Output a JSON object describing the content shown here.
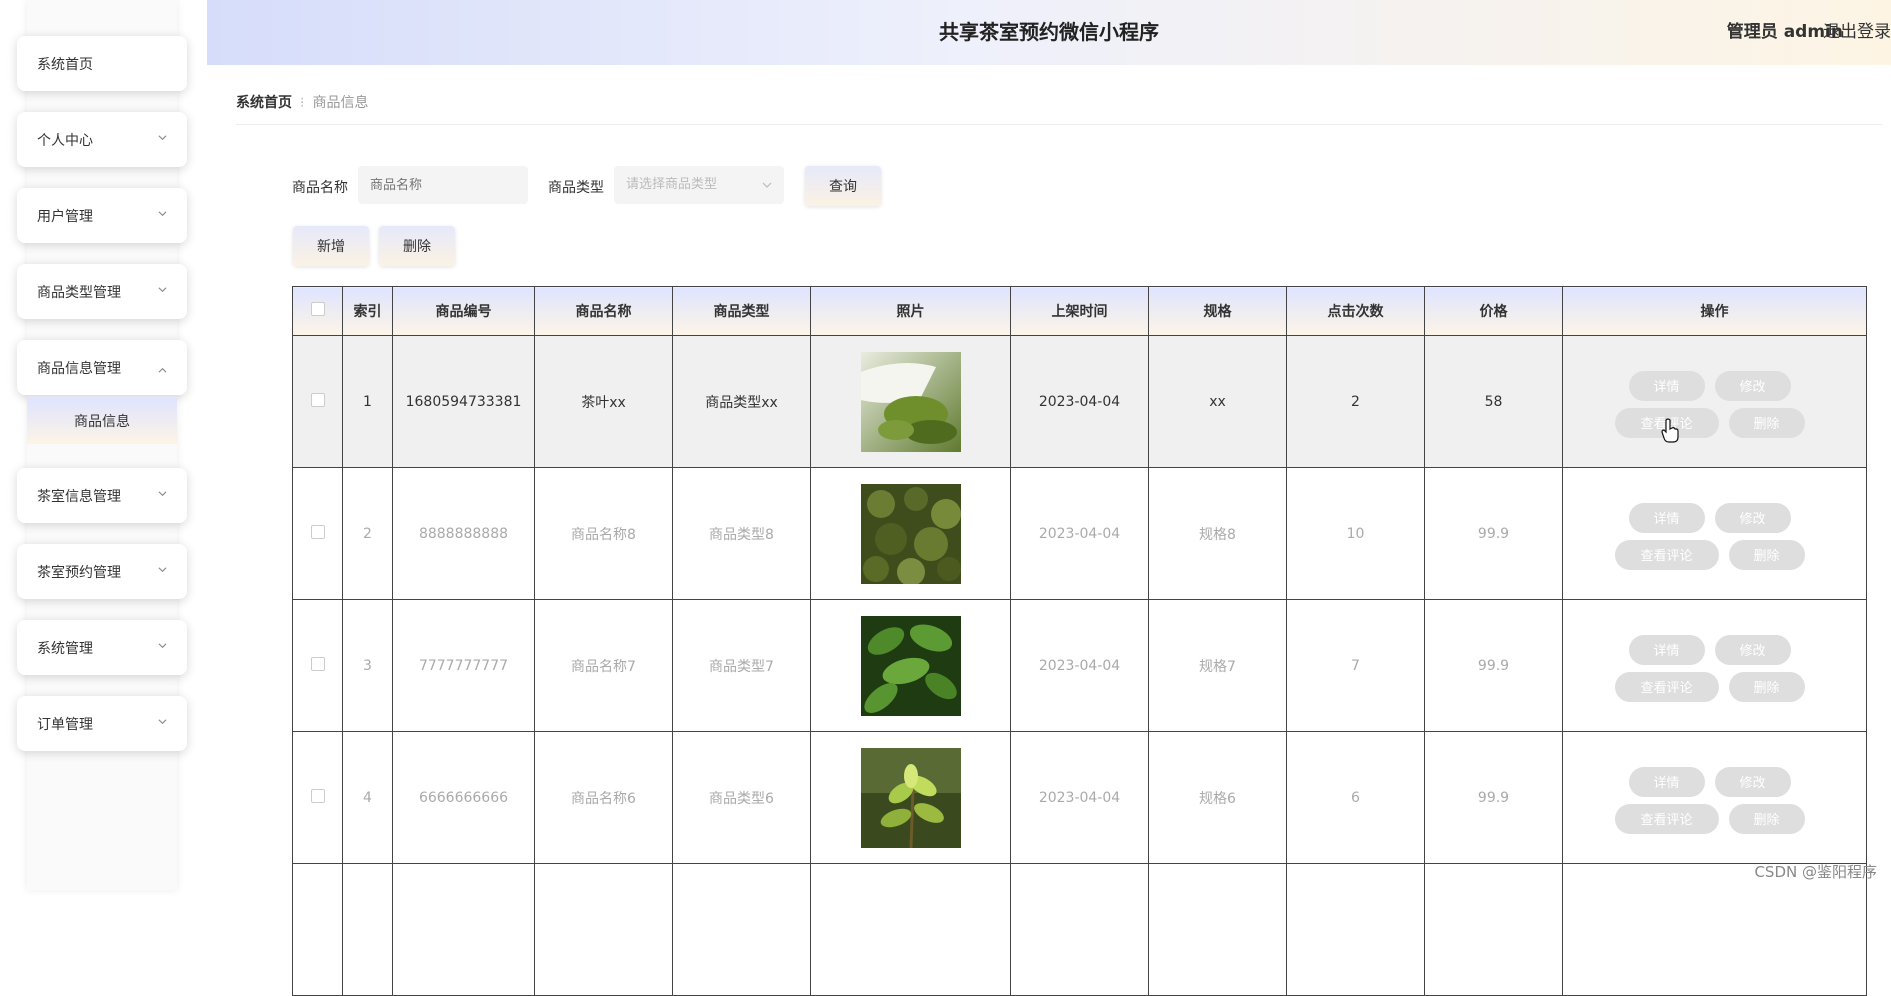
{
  "header": {
    "title": "共享茶室预约微信小程序",
    "user_label": "管理员 admin",
    "logout": "退出登录"
  },
  "sidebar": {
    "items": [
      {
        "label": "系统首页",
        "has_chevron": false
      },
      {
        "label": "个人中心",
        "has_chevron": true
      },
      {
        "label": "用户管理",
        "has_chevron": true
      },
      {
        "label": "商品类型管理",
        "has_chevron": true
      },
      {
        "label": "商品信息管理",
        "has_chevron": true,
        "expanded": true
      },
      {
        "label": "茶室信息管理",
        "has_chevron": true
      },
      {
        "label": "茶室预约管理",
        "has_chevron": true
      },
      {
        "label": "系统管理",
        "has_chevron": true
      },
      {
        "label": "订单管理",
        "has_chevron": true
      }
    ],
    "submenu_active": "商品信息"
  },
  "breadcrumb": {
    "home": "系统首页",
    "separator": "⁝",
    "current": "商品信息"
  },
  "search": {
    "name_label": "商品名称",
    "name_placeholder": "商品名称",
    "type_label": "商品类型",
    "type_placeholder": "请选择商品类型",
    "query_button": "查询"
  },
  "actions": {
    "add": "新增",
    "delete": "删除"
  },
  "table": {
    "columns": [
      "",
      "索引",
      "商品编号",
      "商品名称",
      "商品类型",
      "照片",
      "上架时间",
      "规格",
      "点击次数",
      "价格",
      "操作"
    ],
    "rows": [
      {
        "index": "1",
        "code": "1680594733381",
        "name": "茶叶xx",
        "type": "商品类型xx",
        "photo": "tea-leaves-in-scoop",
        "date": "2023-04-04",
        "spec": "xx",
        "clicks": "2",
        "price": "58"
      },
      {
        "index": "2",
        "code": "8888888888",
        "name": "商品名称8",
        "type": "商品类型8",
        "photo": "dried-tea-leaves",
        "date": "2023-04-04",
        "spec": "规格8",
        "clicks": "10",
        "price": "99.9"
      },
      {
        "index": "3",
        "code": "7777777777",
        "name": "商品名称7",
        "type": "商品类型7",
        "photo": "fresh-tea-leaves",
        "date": "2023-04-04",
        "spec": "规格7",
        "clicks": "7",
        "price": "99.9"
      },
      {
        "index": "4",
        "code": "6666666666",
        "name": "商品名称6",
        "type": "商品类型6",
        "photo": "tea-bud",
        "date": "2023-04-04",
        "spec": "规格6",
        "clicks": "6",
        "price": "99.9"
      }
    ],
    "row_actions": {
      "detail": "详情",
      "edit": "修改",
      "review": "查看评论",
      "delete": "删除"
    }
  },
  "watermark": "CSDN @鉴阳程序",
  "colors": {
    "header_start": "#d6ddfa",
    "header_end": "#fdf4e4",
    "button_disabled": "#dedede",
    "row_highlight": "#f0f0f0"
  }
}
